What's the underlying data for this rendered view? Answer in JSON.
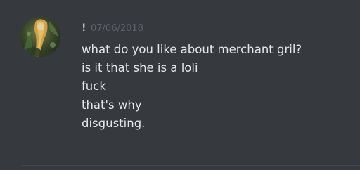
{
  "message": {
    "author": "!",
    "timestamp": "07/06/2018",
    "lines": [
      "what do you like about merchant gril?",
      "is it that she is a loli",
      "fuck",
      "that's why",
      "disgusting."
    ]
  },
  "colors": {
    "background": "#36393e",
    "message_text": "#e4e5e7",
    "timestamp": "#5d6066",
    "divider": "#43464c"
  },
  "icons": {
    "avatar": "user-avatar-image"
  }
}
